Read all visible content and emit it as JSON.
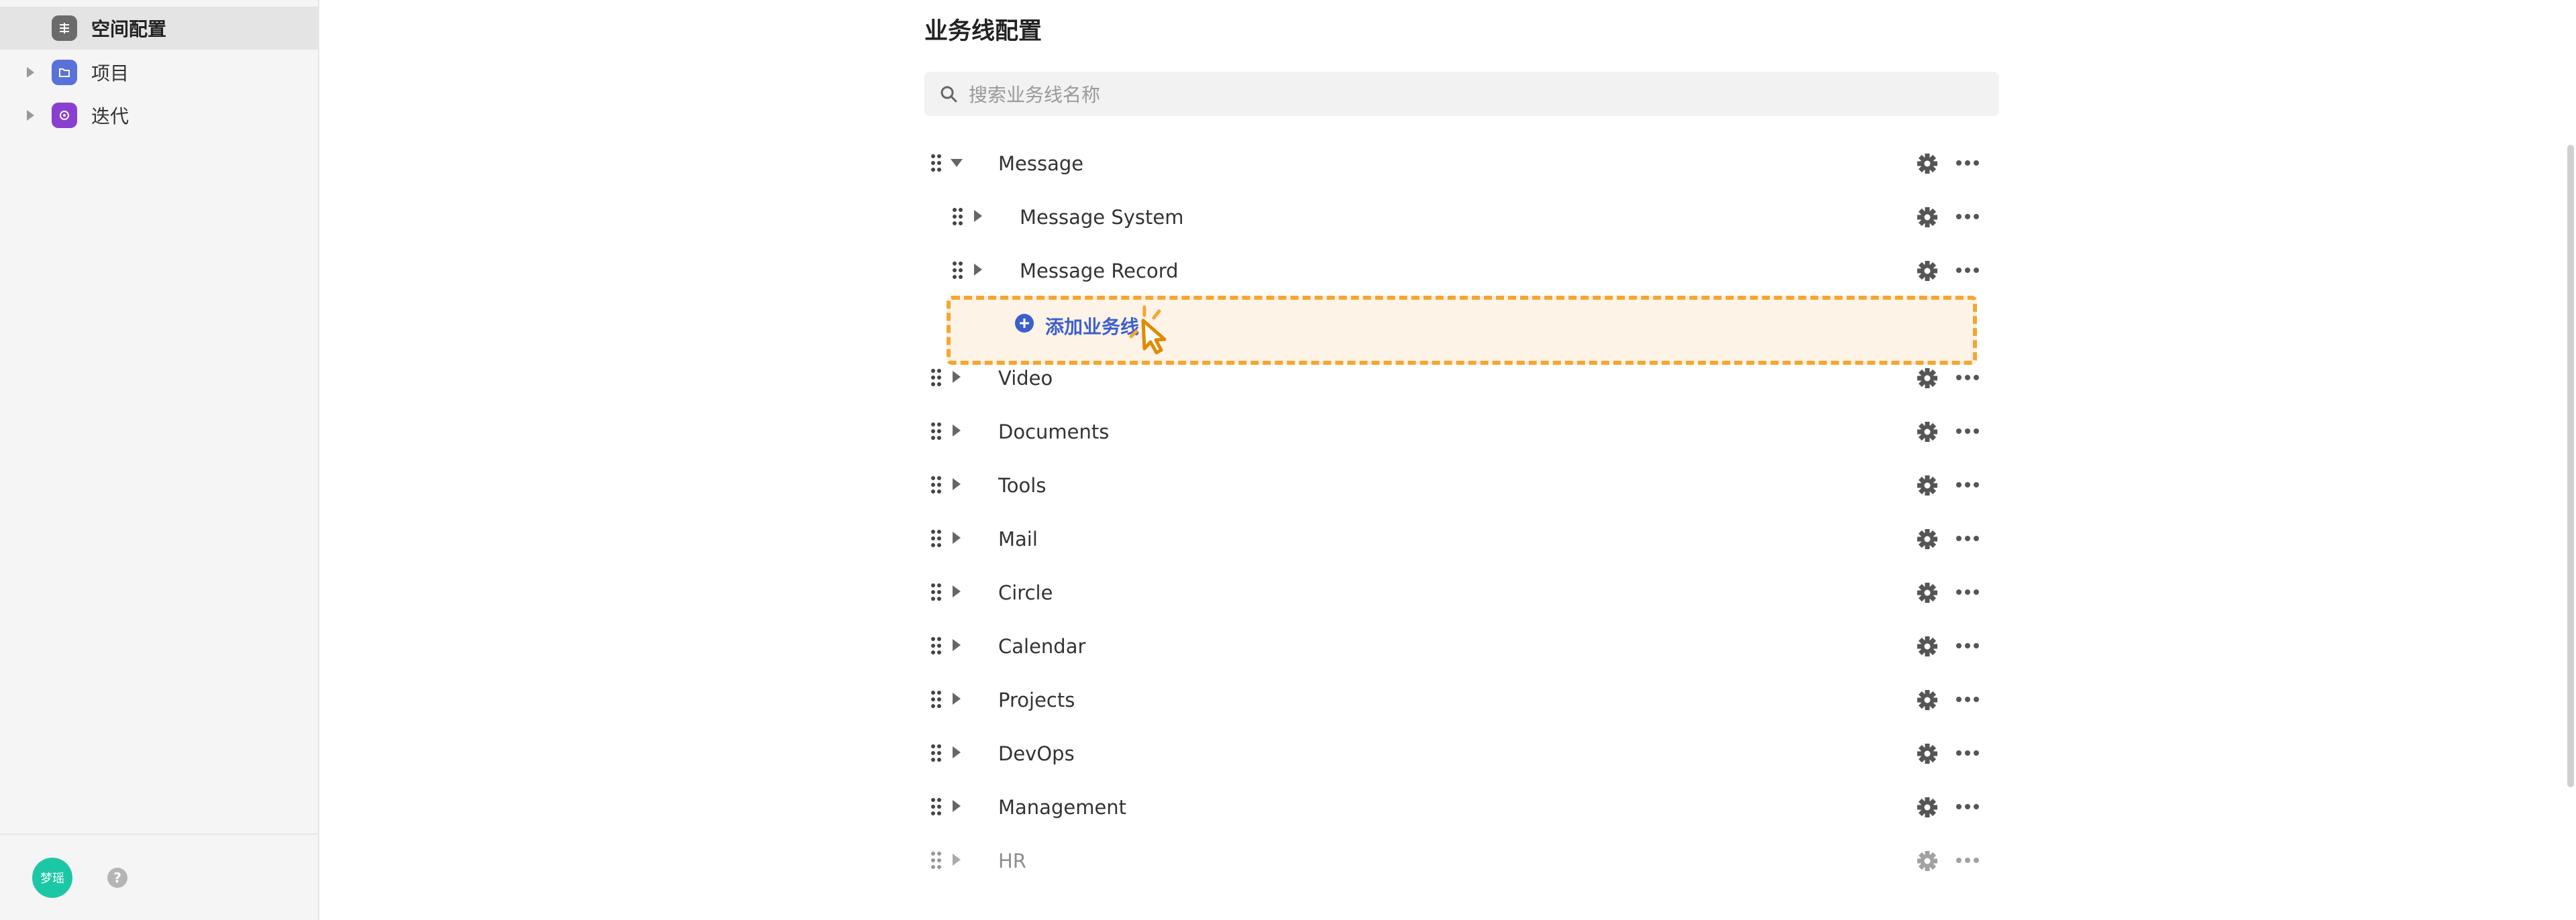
{
  "sidebar": {
    "items": [
      {
        "label": "空间配置",
        "icon": "grid-icon",
        "active": true
      },
      {
        "label": "项目",
        "icon": "folder-icon",
        "active": false
      },
      {
        "label": "迭代",
        "icon": "iteration-icon",
        "active": false
      }
    ],
    "avatar_text": "梦瑶",
    "help_glyph": "?"
  },
  "main": {
    "title": "业务线配置",
    "search": {
      "placeholder": "搜索业务线名称"
    },
    "add_label": "添加业务线",
    "rows": [
      {
        "label": "Message",
        "level": 0,
        "expanded": true
      },
      {
        "label": "Message System",
        "level": 1,
        "expanded": false
      },
      {
        "label": "Message Record",
        "level": 1,
        "expanded": false
      },
      {
        "label": "Video",
        "level": 0,
        "expanded": false
      },
      {
        "label": "Documents",
        "level": 0,
        "expanded": false
      },
      {
        "label": "Tools",
        "level": 0,
        "expanded": false
      },
      {
        "label": "Mail",
        "level": 0,
        "expanded": false
      },
      {
        "label": "Circle",
        "level": 0,
        "expanded": false
      },
      {
        "label": "Calendar",
        "level": 0,
        "expanded": false
      },
      {
        "label": "Projects",
        "level": 0,
        "expanded": false
      },
      {
        "label": "DevOps",
        "level": 0,
        "expanded": false
      },
      {
        "label": "Management",
        "level": 0,
        "expanded": false
      },
      {
        "label": "HR",
        "level": 0,
        "expanded": false
      }
    ]
  },
  "colors": {
    "accent": "#3b5fcf",
    "highlight_border": "#f5a630",
    "highlight_fill": "#fdf3e6",
    "avatar": "#1cc7a6"
  }
}
